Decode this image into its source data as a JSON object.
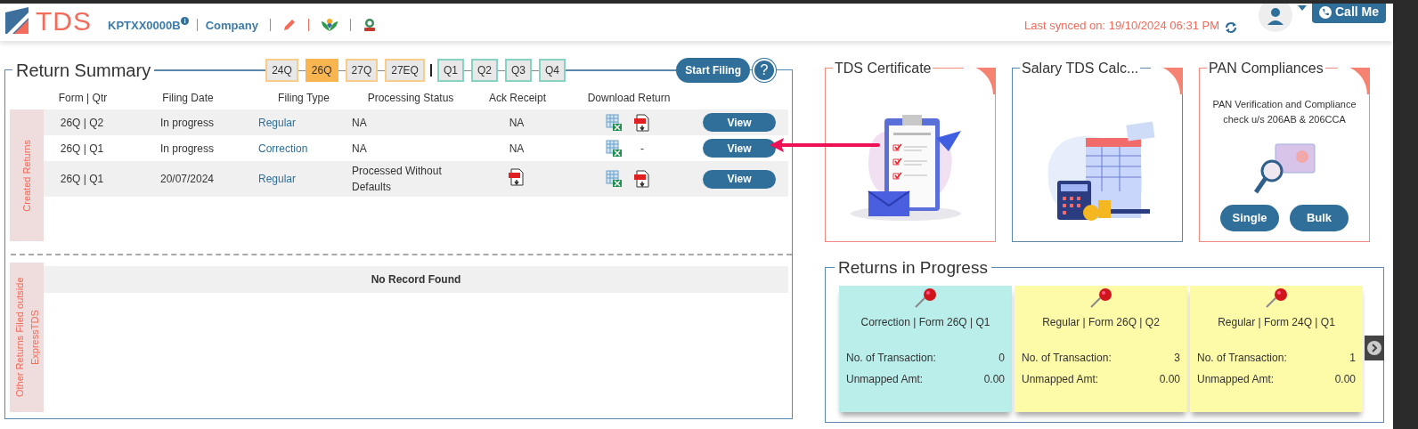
{
  "header": {
    "logo": "TDS",
    "tan": "KPTXX0000B",
    "entity_type": "Company",
    "last_synced": "Last synced on: 19/10/2024 06:31 PM",
    "call_button": "Call Me"
  },
  "return_summary": {
    "title": "Return Summary",
    "forms": [
      {
        "label": "24Q",
        "selected": false
      },
      {
        "label": "26Q",
        "selected": true
      },
      {
        "label": "27Q",
        "selected": false
      },
      {
        "label": "27EQ",
        "selected": false
      }
    ],
    "quarters": [
      {
        "label": "Q1",
        "selected": false
      },
      {
        "label": "Q2",
        "selected": false
      },
      {
        "label": "Q3",
        "selected": false
      },
      {
        "label": "Q4",
        "selected": false
      }
    ],
    "start_button": "Start Filing",
    "help": "?",
    "columns": [
      "Form | Qtr",
      "Filing Date",
      "Filing Type",
      "Processing Status",
      "Ack Receipt",
      "Download Return"
    ],
    "created_label": "Created Returns",
    "rows": [
      {
        "form_qtr": "26Q | Q2",
        "filing_date": "In progress",
        "filing_type": "Regular",
        "status": "NA",
        "ack": {
          "kind": "text",
          "text": "NA"
        },
        "downloads": [
          {
            "kind": "excel"
          },
          {
            "kind": "pdf"
          }
        ],
        "action": "View"
      },
      {
        "form_qtr": "26Q | Q1",
        "filing_date": "In progress",
        "filing_type": "Correction",
        "status": "NA",
        "ack": {
          "kind": "text",
          "text": "NA"
        },
        "downloads": [
          {
            "kind": "excel"
          },
          {
            "kind": "text",
            "text": "-"
          }
        ],
        "action": "View"
      },
      {
        "form_qtr": "26Q | Q1",
        "filing_date": "20/07/2024",
        "filing_type": "Regular",
        "status": "Processed Without Defaults",
        "ack": {
          "kind": "pdf"
        },
        "downloads": [
          {
            "kind": "excel"
          },
          {
            "kind": "pdf"
          }
        ],
        "action": "View"
      }
    ],
    "other_label": "Other Returns Filed outside ExpressTDS",
    "other_empty": "No Record Found"
  },
  "tiles": [
    {
      "kind": "certificate",
      "title": "TDS Certificate"
    },
    {
      "kind": "salary",
      "title": "Salary TDS Calc..."
    },
    {
      "kind": "pan",
      "title": "PAN Compliances",
      "description": "PAN Verification and Compliance check u/s 206AB & 206CCA",
      "buttons": [
        "Single",
        "Bulk"
      ]
    }
  ],
  "returns_in_progress": {
    "title": "Returns in Progress",
    "cards": [
      {
        "title": "Correction | Form 26Q | Q1",
        "color": "#b9eeea",
        "transactions_label": "No. of Transaction:",
        "transactions": "0",
        "unmapped_label": "Unmapped Amt:",
        "unmapped": "0.00"
      },
      {
        "title": "Regular | Form 26Q | Q2",
        "color": "#fdfaa8",
        "transactions_label": "No. of Transaction:",
        "transactions": "3",
        "unmapped_label": "Unmapped Amt:",
        "unmapped": "0.00"
      },
      {
        "title": "Regular | Form 24Q | Q1",
        "color": "#fdfaa8",
        "transactions_label": "No. of Transaction:",
        "transactions": "1",
        "unmapped_label": "Unmapped Amt:",
        "unmapped": "0.00"
      }
    ]
  }
}
